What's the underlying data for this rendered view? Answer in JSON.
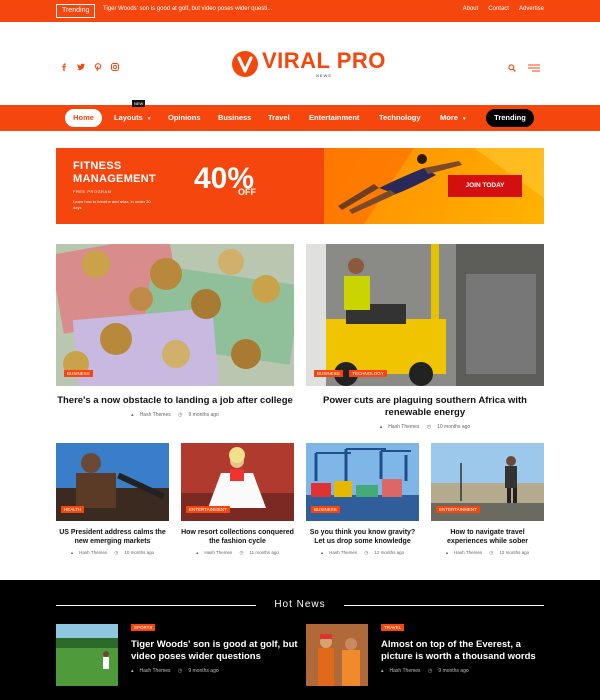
{
  "topbar": {
    "trending_label": "Trending",
    "ticker_text": "Tiger Woods' son is good at golf, but video poses wider questi...",
    "links": [
      "About",
      "Contact",
      "Advertise"
    ]
  },
  "header": {
    "social_icons": [
      "facebook-icon",
      "twitter-icon",
      "pinterest-icon",
      "instagram-icon"
    ],
    "logo_title": "VIRAL PRO",
    "logo_sub": "NEWS"
  },
  "nav": {
    "home": "Home",
    "layouts": "Layouts",
    "new_badge": "NEW",
    "opinions": "Opinions",
    "business": "Business",
    "travel": "Travel",
    "entertainment": "Entertainment",
    "technology": "Technology",
    "more": "More",
    "trending": "Trending"
  },
  "ad": {
    "title_line1": "FITNESS",
    "title_line2": "MANAGEMENT",
    "free_program": "FREE PROGRAM",
    "desc": "Learn how to breathe and relax, in under 30 days",
    "percent": "40%",
    "off": "OFF",
    "button": "JOIN TODAY"
  },
  "features": [
    {
      "categories": [
        "BUSINESS"
      ],
      "title": "There's a now obstacle to landing a job after college",
      "author": "Hash Themes",
      "time": "9 months ago"
    },
    {
      "categories": [
        "BUSINESS",
        "TECHNOLOGY"
      ],
      "title": "Power cuts are plaguing southern Africa with renewable energy",
      "author": "Hash Themes",
      "time": "10 months ago"
    }
  ],
  "small_articles": [
    {
      "category": "HEALTH",
      "title": "US President address calms the new emerging markets",
      "author": "Hash Themes",
      "time": "10 months ago"
    },
    {
      "category": "ENTERTAINMENT",
      "title": "How resort collections conquered the fashion cycle",
      "author": "Hash Themes",
      "time": "11 months ago"
    },
    {
      "category": "BUSINESS",
      "title": "So you think you know gravity? Let us drop some knowledge",
      "author": "Hash Themes",
      "time": "12 months ago"
    },
    {
      "category": "ENTERTAINMENT",
      "title": "How to navigate travel experiences while sober",
      "author": "Hash Themes",
      "time": "12 months ago"
    }
  ],
  "hot_news": {
    "title": "Hot News",
    "items": [
      {
        "category": "SPORTS",
        "title": "Tiger Woods' son is good at golf, but video poses wider questions",
        "author": "Hash Themes",
        "time": "9 months ago"
      },
      {
        "category": "TRAVEL",
        "title": "Almost on top of the Everest, a picture is worth a thousand words",
        "author": "Hash Themes",
        "time": "9 months ago"
      }
    ]
  },
  "colors": {
    "accent": "#f5460d",
    "dark": "#000000"
  }
}
